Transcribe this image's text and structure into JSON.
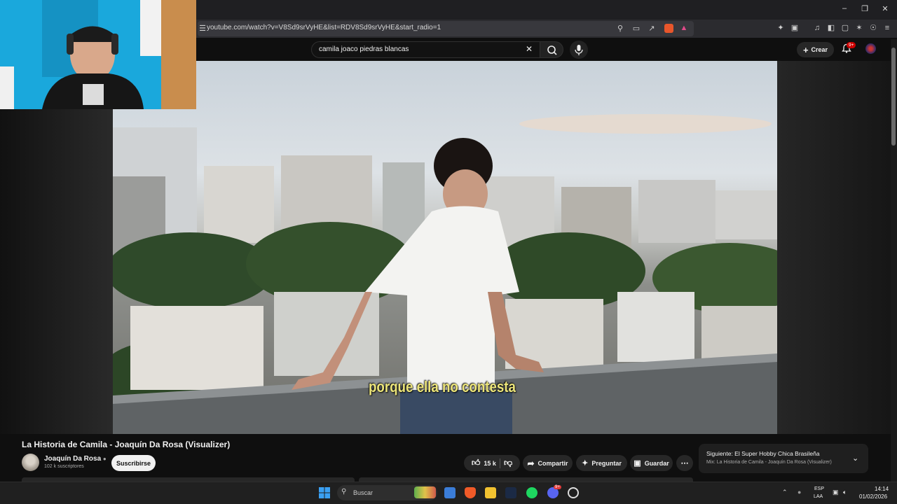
{
  "browser": {
    "url": "youtube.com/watch?v=V8Sd9srVyHE&list=RDV8Sd9srVyHE&start_radio=1",
    "window_controls": [
      "minimize",
      "restore",
      "close"
    ]
  },
  "youtube": {
    "search_query": "camila joaco piedras blancas",
    "create_label": "Crear",
    "notifications_badge": "9+"
  },
  "video": {
    "subtitle": "porque ella no contesta",
    "title": "La Historia de Camila - Joaquín Da Rosa (Visualizer)"
  },
  "channel": {
    "name": "Joaquín Da Rosa",
    "subscribers": "102 k suscriptores",
    "subscribe_label": "Suscribirse"
  },
  "actions": {
    "likes": "15 k",
    "share_label": "Compartir",
    "ask_label": "Preguntar",
    "save_label": "Guardar"
  },
  "next_up": {
    "label": "Siguiente: El Super Hobby Chica Brasileña",
    "mix": "Mix: La Historia de Camila - Joaquín Da Rosa (Visualizer)"
  },
  "taskbar": {
    "search_label": "Buscar",
    "lang_top": "ESP",
    "lang_bottom": "LAA",
    "time": "14:14",
    "date": "01/02/2026",
    "discord_badge": "9+"
  },
  "colors": {
    "subtitle": "#ece57a",
    "youtube_red": "#ff0033",
    "accent_blue": "#3ea6ff"
  }
}
